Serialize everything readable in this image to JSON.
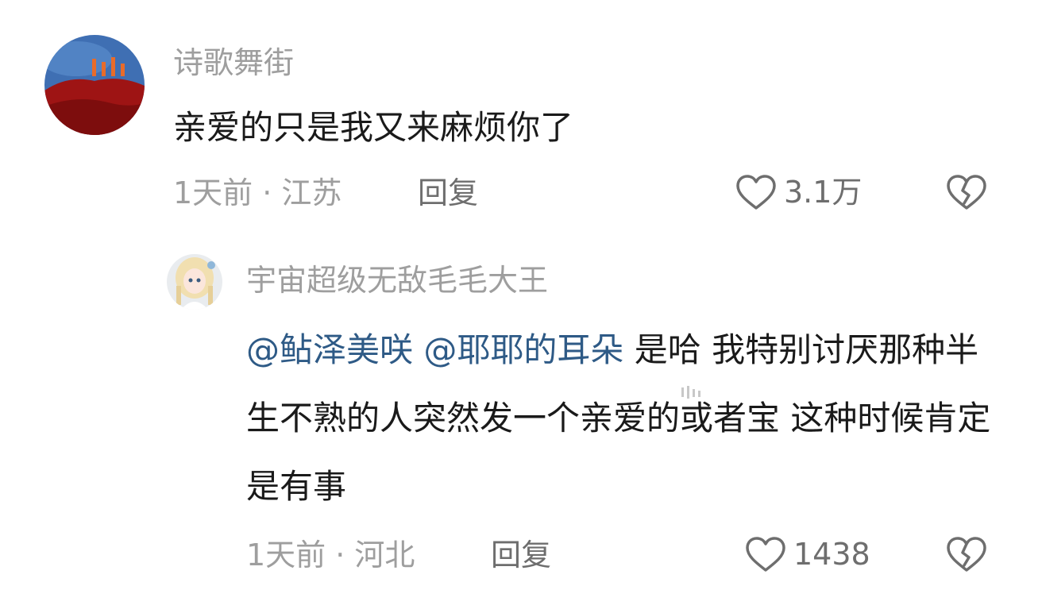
{
  "comment": {
    "username": "诗歌舞街",
    "text": "亲爱的只是我又来麻烦你了",
    "meta": "1天前 · 江苏",
    "reply_label": "回复",
    "like_count": "3.1万"
  },
  "reply": {
    "username": "宇宙超级无敌毛毛大王",
    "mention1": "@鲇泽美咲",
    "mention2": "@耶耶的耳朵",
    "text": " 是哈 我特别讨厌那种半生不熟的人突然发一个亲爱的或者宝 这种时候肯定是有事",
    "meta": "1天前 · 河北",
    "reply_label": "回复",
    "like_count": "1438"
  },
  "icons": {
    "like": "heart-outline-icon",
    "dislike": "broken-heart-icon"
  },
  "colors": {
    "mention": "#2e5a86",
    "secondary_text": "#9e9e9e",
    "primary_text": "#1a1a1a"
  }
}
